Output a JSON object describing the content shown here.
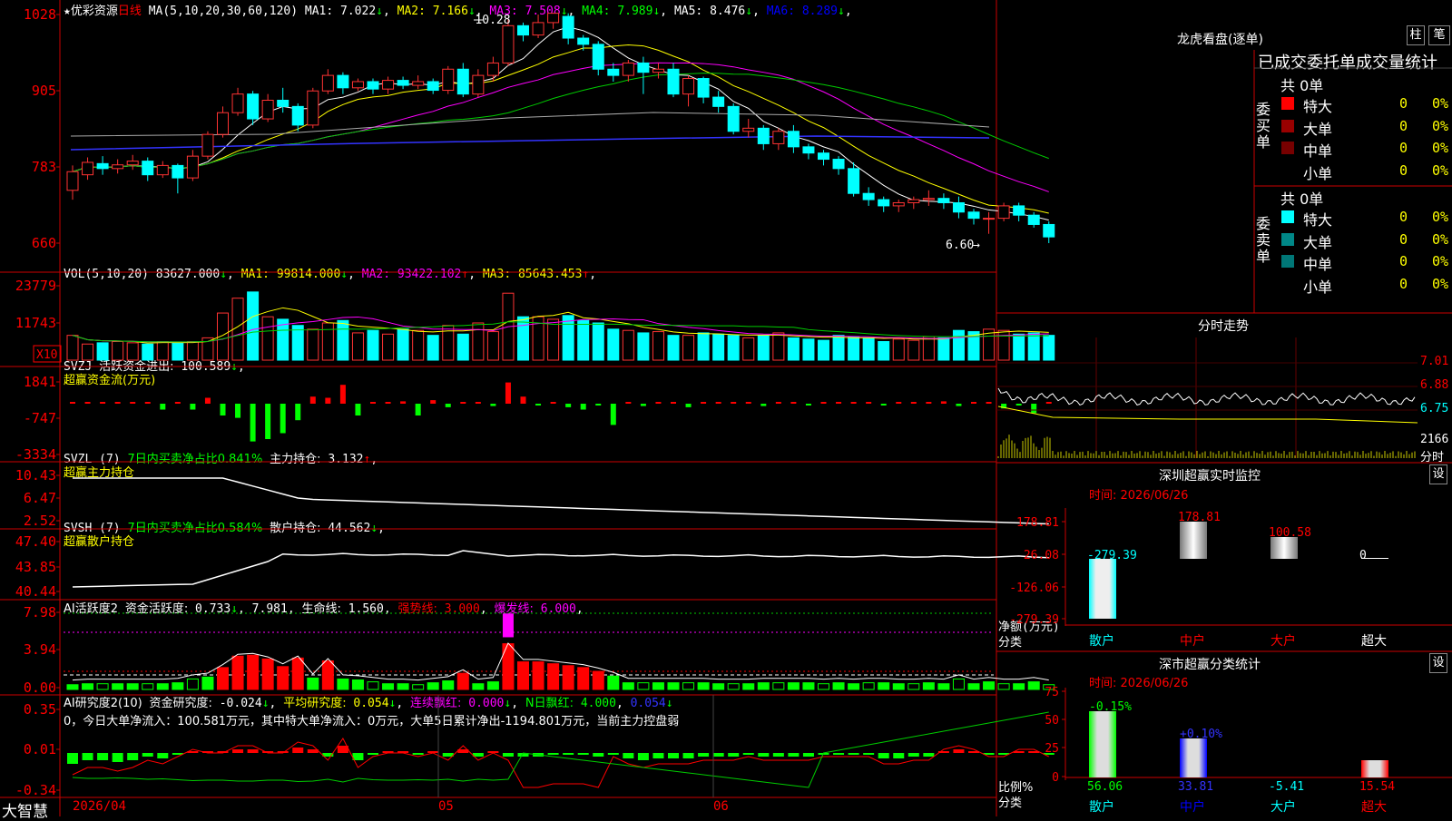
{
  "stock": {
    "name": "优彩资源",
    "period": "日线",
    "star": "★"
  },
  "main_ma": {
    "label": "MA(5,10,20,30,60,120)",
    "items": [
      {
        "k": "MA1:",
        "v": "7.022",
        "a": "↓",
        "c": "#ffffff"
      },
      {
        "k": "MA2:",
        "v": "7.166",
        "a": "↓",
        "c": "#ffff00"
      },
      {
        "k": "MA3:",
        "v": "7.508",
        "a": "↓",
        "c": "#ff00ff"
      },
      {
        "k": "MA4:",
        "v": "7.989",
        "a": "↓",
        "c": "#00ff00"
      },
      {
        "k": "MA5:",
        "v": "8.476",
        "a": "↓",
        "c": "#ffffff"
      },
      {
        "k": "MA6:",
        "v": "8.289",
        "a": "↓",
        "c": "#0000ff"
      }
    ],
    "y_ticks": [
      "1028",
      "905",
      "783",
      "660"
    ],
    "high_label": "10.28",
    "low_label": "6.60"
  },
  "vol": {
    "label": "VOL(5,10,20)",
    "value": "83627.000",
    "value_arrow": "↓",
    "items": [
      {
        "k": "MA1:",
        "v": "99814.000",
        "a": "↓",
        "c": "#ffff00"
      },
      {
        "k": "MA2:",
        "v": "93422.102",
        "a": "↑",
        "c": "#ff00ff"
      },
      {
        "k": "MA3:",
        "v": "85643.453",
        "a": "↑",
        "c": "#ffff00"
      }
    ],
    "y_ticks": [
      "23779",
      "11743"
    ],
    "unit": "X10"
  },
  "svzj": {
    "label": "SVZJ",
    "k": "活跃资金进出:",
    "v": "100.589",
    "a": "↓",
    "sub": "超赢资金流(万元)",
    "y_ticks": [
      "1841",
      "-747",
      "-3334"
    ]
  },
  "svzl": {
    "label": "SVZL (7)",
    "k1": "7日内买卖净占比0.841%",
    "k2": "主力持仓:",
    "v": "3.132",
    "a": "↑",
    "sub": "超赢主力持仓",
    "y_ticks": [
      "10.43",
      "6.47",
      "2.52"
    ]
  },
  "svsh": {
    "label": "SVSH (7)",
    "k1": "7日内买卖净占比0.584%",
    "k2": "散户持仓:",
    "v": "44.562",
    "a": "↓",
    "sub": "超赢散户持仓",
    "y_ticks": [
      "47.40",
      "43.85",
      "40.44"
    ]
  },
  "ai1": {
    "label": "AI活跃度2",
    "k1": "资金活跃度:",
    "v1": "0.733",
    "a1": "↓",
    "v2": "7.981",
    "k3": "生命线:",
    "v3": "1.560",
    "k4": "强势线:",
    "v4": "3.000",
    "k5": "爆发线:",
    "v5": "6.000",
    "y_ticks": [
      "7.98",
      "3.94",
      "0.00"
    ]
  },
  "ai2": {
    "label": "AI研究度2(10)",
    "k1": "资金研究度:",
    "v1": "-0.024",
    "a1": "↓",
    "k2": "平均研究度:",
    "v2": "0.054",
    "a2": "↓",
    "k3": "连续飘红:",
    "v3": "0.000",
    "a3": "↓",
    "k4": "N日飘红:",
    "v4": "4.000",
    "v5": "0.054",
    "a5": "↓",
    "note": "0，今日大单净流入：100.581万元，其中特大单净流入：0万元，大单5日累计净出-1194.801万元，当前主力控盘弱",
    "y_ticks": [
      "0.35",
      "0.01",
      "-0.34"
    ]
  },
  "xaxis": {
    "logo": "大智慧",
    "date0": "2026/04",
    "m5": "05",
    "m6": "06"
  },
  "right": {
    "title": "龙虎看盘(逐单)",
    "tab1": "柱",
    "tab2": "笔",
    "header": "已成交委托单成交量统计",
    "buy": {
      "side": "委买单",
      "total": "共 0单",
      "rows": [
        {
          "label": "特大",
          "vol": "0",
          "pct": "0%",
          "color": "#ff0000"
        },
        {
          "label": "大单",
          "vol": "0",
          "pct": "0%",
          "color": "#990000"
        },
        {
          "label": "中单",
          "vol": "0",
          "pct": "0%",
          "color": "#770000"
        },
        {
          "label": "小单",
          "vol": "0",
          "pct": "0%",
          "color": ""
        }
      ]
    },
    "sell": {
      "side": "委卖单",
      "total": "共 0单",
      "rows": [
        {
          "label": "特大",
          "vol": "0",
          "pct": "0%",
          "color": "#00ffff"
        },
        {
          "label": "大单",
          "vol": "0",
          "pct": "0%",
          "color": "#008888"
        },
        {
          "label": "中单",
          "vol": "0",
          "pct": "0%",
          "color": "#007777"
        },
        {
          "label": "小单",
          "vol": "0",
          "pct": "0%",
          "color": ""
        }
      ]
    },
    "intraday": {
      "title": "分时走势",
      "y_ticks": [
        "7.01",
        "6.88",
        "6.75"
      ],
      "vol_tick": "2166",
      "vol_label": "分时"
    },
    "monitor": {
      "title": "深圳超赢实时监控",
      "settings": "设",
      "time": "时间: 2026/06/26",
      "y_ticks": [
        "178.81",
        "26.08",
        "-126.06",
        "-279.39"
      ],
      "ylabel1": "净额(万元)",
      "ylabel2": "分类",
      "bars": [
        {
          "cat": "散户",
          "val": "-279.39"
        },
        {
          "cat": "中户",
          "val": "178.81"
        },
        {
          "cat": "大户",
          "val": "100.58"
        },
        {
          "cat": "超大",
          "val": "0"
        }
      ]
    },
    "classify": {
      "title": "深市超赢分类统计",
      "settings": "设",
      "time": "时间: 2026/06/26",
      "y_ticks": [
        "75",
        "50",
        "25",
        "0"
      ],
      "ylabel1": "比例%",
      "ylabel2": "分类",
      "bars": [
        {
          "cat": "散户",
          "val": "56.06",
          "chg": "-0.15%"
        },
        {
          "cat": "中户",
          "val": "33.81",
          "chg": "+0.10%"
        },
        {
          "cat": "大户",
          "val": "-5.41",
          "chg": ""
        },
        {
          "cat": "超大",
          "val": "15.54",
          "chg": ""
        }
      ]
    }
  },
  "chart_data": {
    "type": "candlestick",
    "title": "优彩资源 日线",
    "ylim": [
      6.6,
      10.28
    ],
    "candles": [
      [
        7.45,
        7.75,
        7.85,
        7.3
      ],
      [
        7.7,
        7.9,
        7.98,
        7.62
      ],
      [
        7.88,
        7.8,
        8.0,
        7.7
      ],
      [
        7.8,
        7.86,
        7.95,
        7.72
      ],
      [
        7.86,
        7.92,
        8.02,
        7.78
      ],
      [
        7.92,
        7.7,
        7.98,
        7.6
      ],
      [
        7.7,
        7.85,
        7.92,
        7.65
      ],
      [
        7.85,
        7.65,
        7.88,
        7.4
      ],
      [
        7.65,
        8.0,
        8.1,
        7.6
      ],
      [
        8.0,
        8.35,
        8.4,
        7.95
      ],
      [
        8.35,
        8.7,
        8.8,
        8.3
      ],
      [
        8.7,
        9.0,
        9.1,
        8.65
      ],
      [
        9.0,
        8.6,
        9.05,
        8.5
      ],
      [
        8.6,
        8.9,
        9.0,
        8.55
      ],
      [
        8.9,
        8.8,
        9.1,
        8.7
      ],
      [
        8.8,
        8.5,
        8.85,
        8.4
      ],
      [
        8.5,
        9.05,
        9.1,
        8.45
      ],
      [
        9.05,
        9.3,
        9.4,
        9.0
      ],
      [
        9.3,
        9.1,
        9.35,
        9.0
      ],
      [
        9.1,
        9.2,
        9.25,
        9.05
      ],
      [
        9.2,
        9.08,
        9.25,
        9.0
      ],
      [
        9.08,
        9.22,
        9.28,
        9.0
      ],
      [
        9.22,
        9.14,
        9.28,
        9.08
      ],
      [
        9.14,
        9.2,
        9.3,
        9.08
      ],
      [
        9.2,
        9.06,
        9.25,
        9.0
      ],
      [
        9.06,
        9.4,
        9.45,
        9.0
      ],
      [
        9.4,
        9.0,
        9.5,
        8.95
      ],
      [
        9.0,
        9.3,
        9.4,
        8.95
      ],
      [
        9.3,
        9.5,
        9.6,
        9.2
      ],
      [
        9.5,
        10.1,
        10.2,
        9.45
      ],
      [
        10.1,
        9.95,
        10.15,
        9.85
      ],
      [
        9.95,
        10.15,
        10.28,
        9.9
      ],
      [
        10.15,
        10.3,
        10.3,
        10.05
      ],
      [
        10.25,
        9.9,
        10.3,
        9.8
      ],
      [
        9.9,
        9.8,
        9.95,
        9.7
      ],
      [
        9.8,
        9.4,
        9.85,
        9.3
      ],
      [
        9.4,
        9.3,
        9.5,
        9.2
      ],
      [
        9.3,
        9.5,
        9.55,
        9.2
      ],
      [
        9.5,
        9.35,
        9.6,
        9.0
      ],
      [
        9.35,
        9.4,
        9.5,
        9.25
      ],
      [
        9.4,
        9.0,
        9.5,
        8.95
      ],
      [
        9.0,
        9.25,
        9.3,
        8.8
      ],
      [
        9.25,
        8.95,
        9.28,
        8.85
      ],
      [
        8.95,
        8.8,
        9.05,
        8.7
      ],
      [
        8.8,
        8.4,
        8.85,
        8.35
      ],
      [
        8.4,
        8.45,
        8.6,
        8.3
      ],
      [
        8.45,
        8.2,
        8.5,
        8.1
      ],
      [
        8.2,
        8.4,
        8.45,
        8.1
      ],
      [
        8.4,
        8.15,
        8.5,
        8.05
      ],
      [
        8.15,
        8.05,
        8.2,
        7.95
      ],
      [
        8.05,
        7.95,
        8.1,
        7.85
      ],
      [
        7.95,
        7.8,
        8.0,
        7.7
      ],
      [
        7.8,
        7.4,
        7.9,
        7.35
      ],
      [
        7.4,
        7.3,
        7.5,
        7.2
      ],
      [
        7.3,
        7.2,
        7.35,
        7.1
      ],
      [
        7.2,
        7.25,
        7.3,
        7.1
      ],
      [
        7.25,
        7.3,
        7.35,
        7.15
      ],
      [
        7.3,
        7.32,
        7.45,
        7.2
      ],
      [
        7.32,
        7.25,
        7.4,
        7.15
      ],
      [
        7.25,
        7.1,
        7.35,
        7.0
      ],
      [
        7.1,
        7.0,
        7.15,
        6.9
      ],
      [
        7.0,
        7.0,
        7.1,
        6.75
      ],
      [
        7.0,
        7.2,
        7.25,
        6.95
      ],
      [
        7.2,
        7.05,
        7.25,
        6.95
      ],
      [
        7.05,
        6.9,
        7.1,
        6.85
      ],
      [
        6.9,
        6.7,
        6.95,
        6.6
      ]
    ],
    "volume": [
      2.0,
      1.3,
      1.4,
      1.5,
      1.4,
      1.3,
      1.5,
      1.4,
      1.5,
      1.8,
      3.8,
      5.0,
      5.5,
      3.5,
      3.3,
      2.8,
      2.5,
      3.0,
      3.2,
      2.2,
      2.4,
      2.1,
      2.5,
      2.4,
      2.0,
      2.8,
      2.1,
      3.0,
      2.3,
      5.4,
      3.5,
      3.5,
      3.3,
      3.6,
      3.2,
      3.0,
      2.5,
      2.4,
      2.2,
      2.3,
      2.0,
      2.0,
      2.2,
      2.1,
      2.0,
      1.8,
      2.0,
      2.2,
      1.8,
      1.7,
      1.6,
      2.0,
      1.9,
      1.8,
      1.5,
      1.7,
      1.6,
      1.9,
      1.8,
      2.4,
      2.3,
      2.5,
      2.4,
      2.1,
      2.2,
      2.0
    ]
  }
}
